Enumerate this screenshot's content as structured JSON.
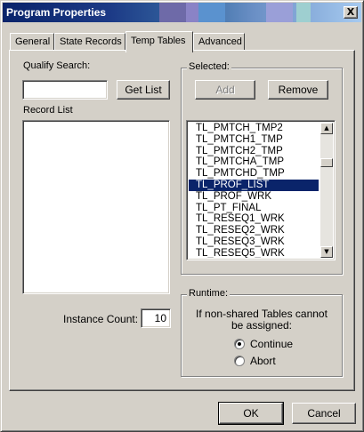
{
  "window": {
    "title": "Program Properties",
    "close_label": "X"
  },
  "tabs": [
    {
      "label": "General"
    },
    {
      "label": "State Records"
    },
    {
      "label": "Temp Tables"
    },
    {
      "label": "Advanced"
    }
  ],
  "qualify": {
    "label": "Qualify Search:",
    "value": "",
    "get_list_label": "Get List"
  },
  "record_list": {
    "label": "Record List"
  },
  "selected": {
    "legend": "Selected:",
    "add_label": "Add",
    "remove_label": "Remove",
    "items": [
      "TL_PMTCH_TMP2",
      "TL_PMTCH1_TMP",
      "TL_PMTCH2_TMP",
      "TL_PMTCHA_TMP",
      "TL_PMTCHD_TMP",
      "TL_PROF_LIST",
      "TL_PROF_WRK",
      "TL_PT_FINAL",
      "TL_RESEQ1_WRK",
      "TL_RESEQ2_WRK",
      "TL_RESEQ3_WRK",
      "TL_RESEQ5_WRK"
    ],
    "selected_item": "TL_PROF_LIST"
  },
  "instance": {
    "label": "Instance Count:",
    "value": "10"
  },
  "runtime": {
    "legend": "Runtime:",
    "message": "If non-shared Tables cannot",
    "message2": "be assigned:",
    "options": [
      {
        "label": "Continue",
        "checked": true
      },
      {
        "label": "Abort",
        "checked": false
      }
    ]
  },
  "footer": {
    "ok_label": "OK",
    "cancel_label": "Cancel"
  }
}
